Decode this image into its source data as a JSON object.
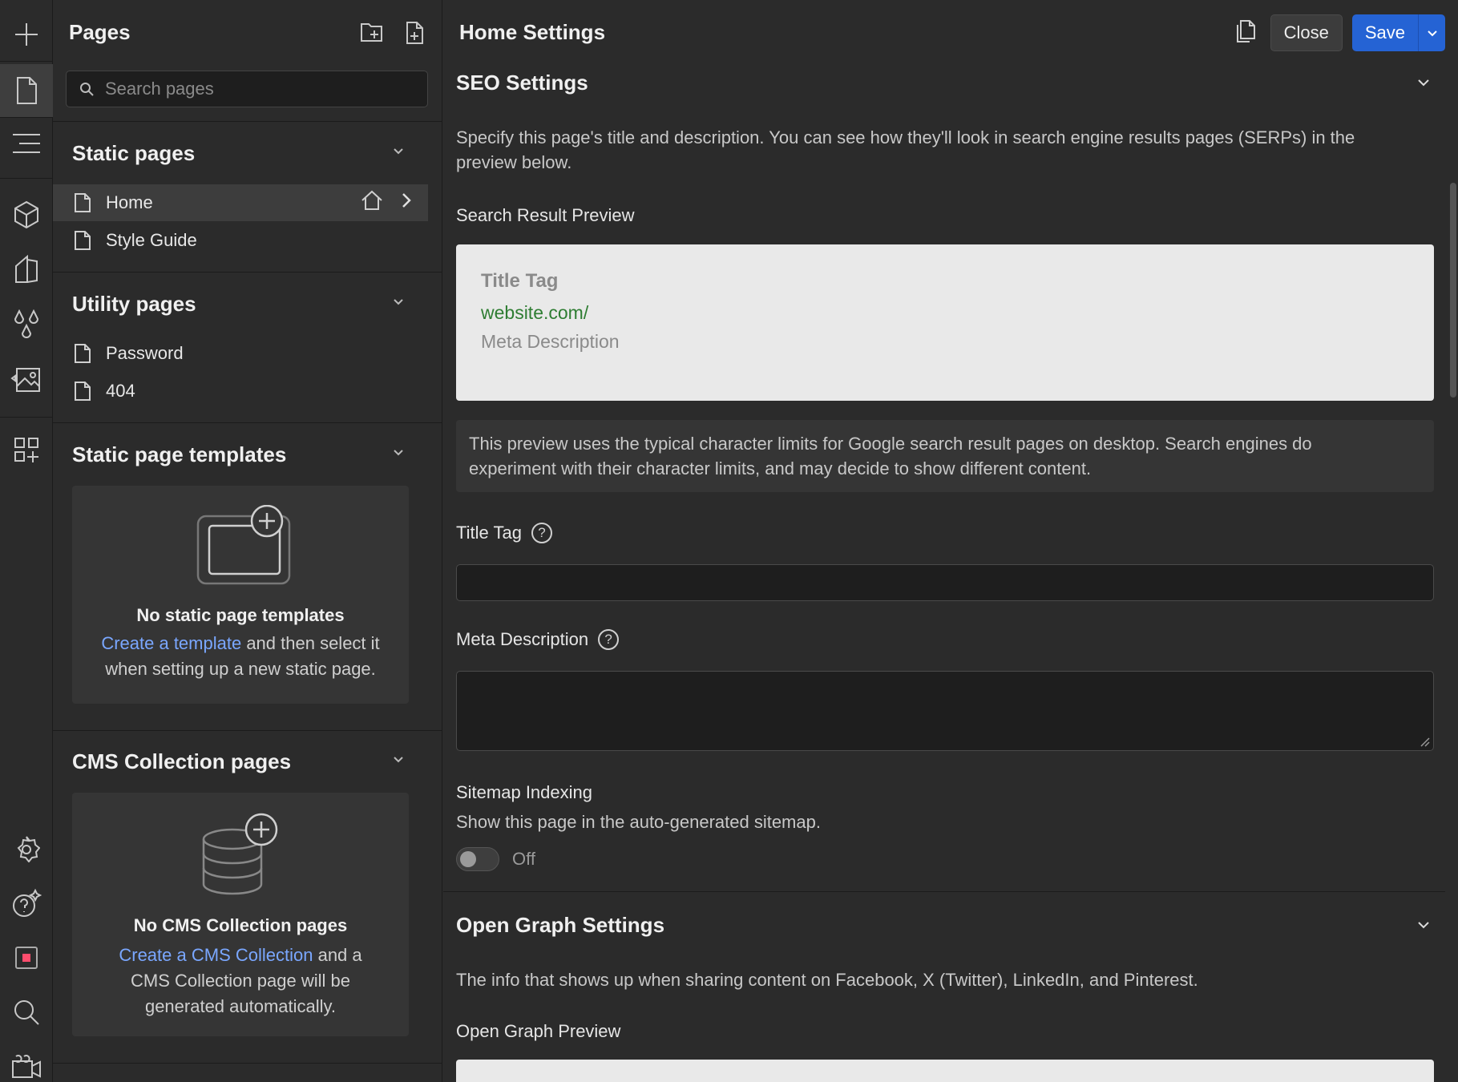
{
  "pages_panel": {
    "title": "Pages",
    "search_placeholder": "Search pages",
    "static_pages": {
      "title": "Static pages",
      "items": [
        "Home",
        "Style Guide"
      ]
    },
    "utility_pages": {
      "title": "Utility pages",
      "items": [
        "Password",
        "404"
      ]
    },
    "static_templates": {
      "title": "Static page templates",
      "empty_title": "No static page templates",
      "empty_link": "Create a template",
      "empty_rest1": " and then select it",
      "empty_rest2": "when setting up a new static page."
    },
    "cms_pages": {
      "title": "CMS Collection pages",
      "empty_title": "No CMS Collection pages",
      "empty_link": "Create a CMS Collection",
      "empty_rest1": " and a",
      "empty_rest2": "CMS Collection page will be",
      "empty_rest3": "generated automatically."
    }
  },
  "settings": {
    "title": "Home Settings",
    "close_label": "Close",
    "save_label": "Save",
    "seo": {
      "title": "SEO Settings",
      "description_1": "Specify this page's title and description. You can see how they'll look in search engine results pages (SERPs) in the",
      "description_2": "preview below.",
      "preview_label": "Search Result Preview",
      "preview_title": "Title Tag",
      "preview_url": "website.com/",
      "preview_meta": "Meta Description",
      "note_1": "This preview uses the typical character limits for Google search result pages on desktop. Search engines do",
      "note_2": "experiment with their character limits, and may decide to show different content.",
      "title_tag_label": "Title Tag",
      "title_tag_value": "",
      "meta_label": "Meta Description",
      "meta_value": "",
      "sitemap_label": "Sitemap Indexing",
      "sitemap_desc": "Show this page in the auto-generated sitemap.",
      "sitemap_state": "Off"
    },
    "og": {
      "title": "Open Graph Settings",
      "description": "The info that shows up when sharing content on Facebook, X (Twitter), LinkedIn, and Pinterest.",
      "preview_label": "Open Graph Preview"
    }
  },
  "colors": {
    "accent": "#2563d4",
    "link": "#7aa7ff",
    "url_green": "#2e7d32"
  }
}
